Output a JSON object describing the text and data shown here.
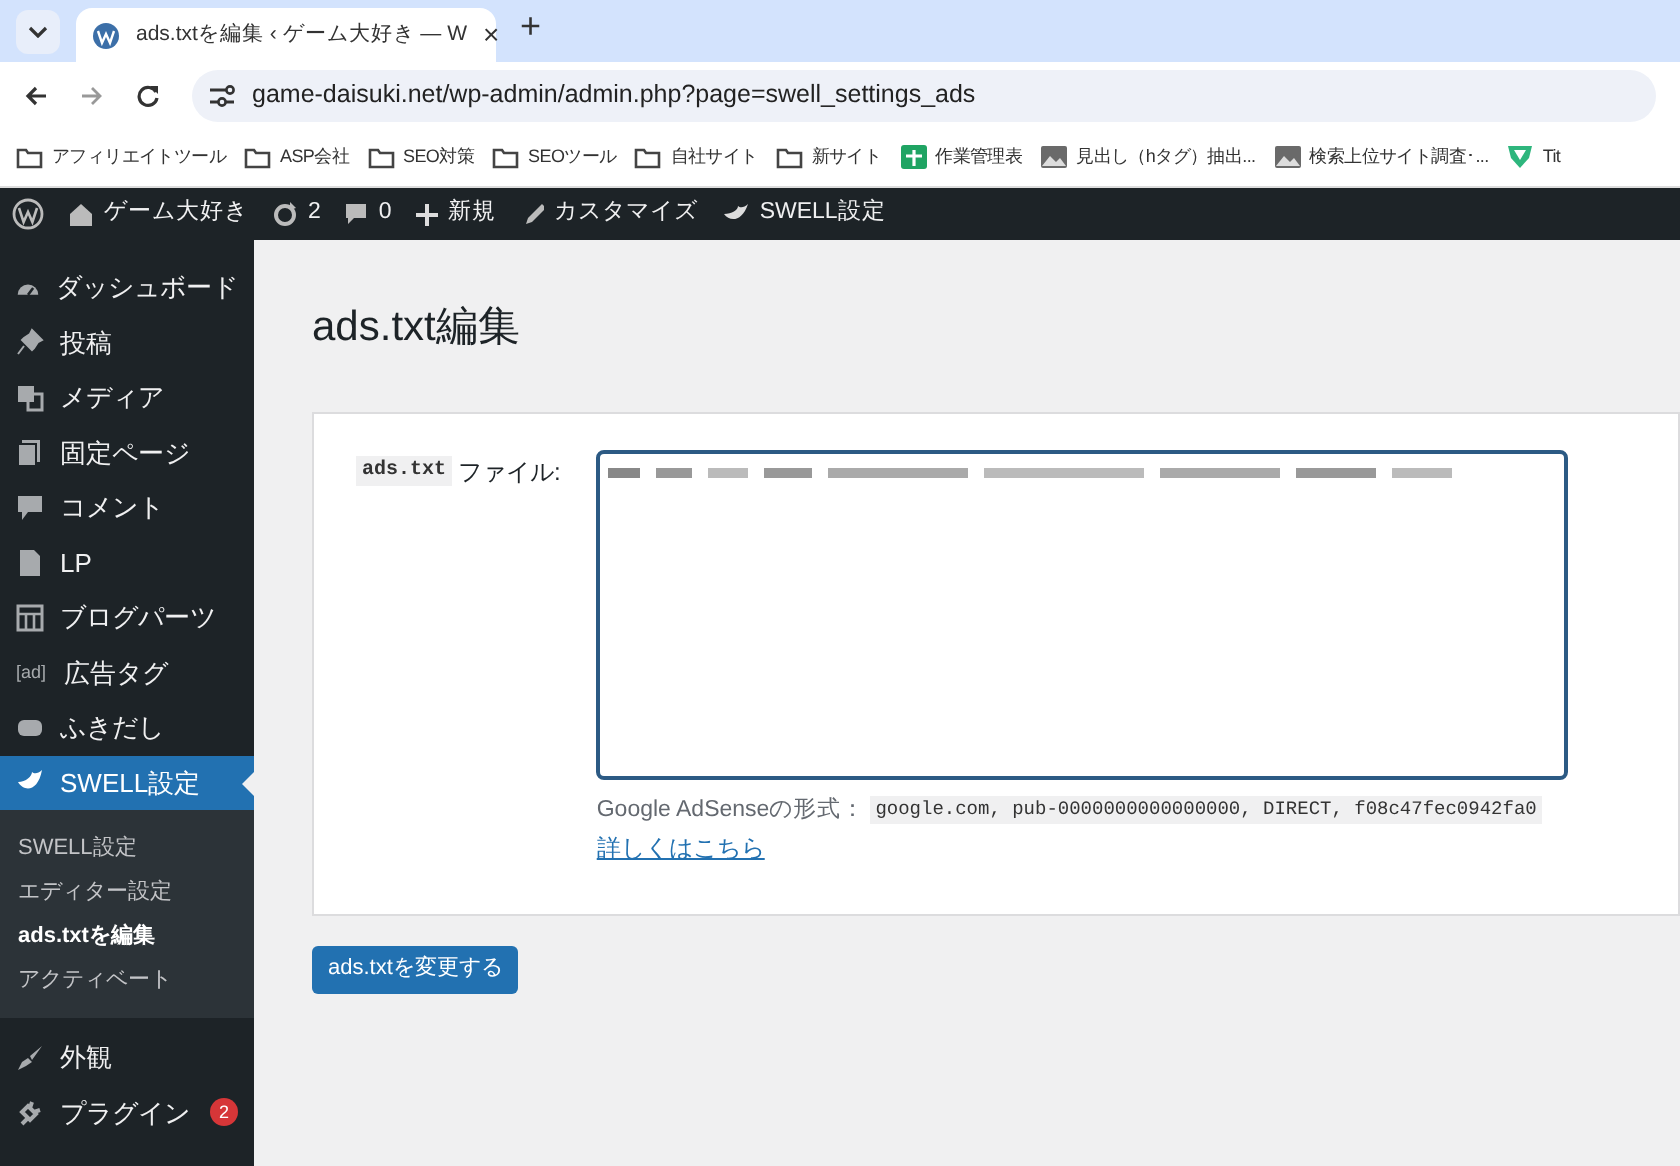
{
  "browser": {
    "tab": {
      "title": "ads.txtを編集 ‹ ゲーム大好き — W",
      "close": "×"
    },
    "new_tab": "+",
    "url": "game-daisuki.net/wp-admin/admin.php?page=swell_settings_ads",
    "bookmarks": [
      {
        "kind": "folder",
        "label": "アフィリエイトツール"
      },
      {
        "kind": "folder",
        "label": "ASP会社"
      },
      {
        "kind": "folder",
        "label": "SEO対策"
      },
      {
        "kind": "folder",
        "label": "SEOツール"
      },
      {
        "kind": "folder",
        "label": "自社サイト"
      },
      {
        "kind": "folder",
        "label": "新サイト"
      },
      {
        "kind": "sheet",
        "label": "作業管理表"
      },
      {
        "kind": "image",
        "label": "見出し（hタグ）抽出..."
      },
      {
        "kind": "image",
        "label": "検索上位サイト調査･..."
      },
      {
        "kind": "shield",
        "label": "Tit"
      }
    ]
  },
  "admin_bar": {
    "site": "ゲーム大好き",
    "updates": "2",
    "comments": "0",
    "new": "新規",
    "customize": "カスタマイズ",
    "swell": "SWELL設定"
  },
  "sidebar": {
    "items": [
      {
        "kind": "dashboard",
        "label": "ダッシュボード",
        "selected": false
      },
      {
        "kind": "pin",
        "label": "投稿",
        "selected": false
      },
      {
        "kind": "media",
        "label": "メディア",
        "selected": false
      },
      {
        "kind": "pages",
        "label": "固定ページ",
        "selected": false
      },
      {
        "kind": "comment",
        "label": "コメント",
        "selected": false
      },
      {
        "kind": "page",
        "label": "LP",
        "selected": false
      },
      {
        "kind": "grid",
        "label": "ブログパーツ",
        "selected": false
      },
      {
        "kind": "ad",
        "label": "広告タグ",
        "icon_text": "[ad]",
        "selected": false
      },
      {
        "kind": "bubble",
        "label": "ふきだし",
        "selected": false
      },
      {
        "kind": "swell",
        "label": "SWELL設定",
        "selected": true,
        "children": [
          {
            "label": "SWELL設定",
            "selected": false
          },
          {
            "label": "エディター設定",
            "selected": false
          },
          {
            "label": "ads.txtを編集",
            "selected": true
          },
          {
            "label": "アクティベート",
            "selected": false
          }
        ]
      },
      {
        "kind": "brush",
        "label": "外観",
        "selected": false
      },
      {
        "kind": "plug",
        "label": "プラグイン",
        "badge": "2",
        "selected": false
      }
    ]
  },
  "page": {
    "title": "ads.txt編集",
    "field_label_code": "ads.txt",
    "field_label": "ファイル:",
    "hint_label": "Google AdSenseの形式：",
    "hint_code": "google.com, pub-0000000000000000, DIRECT, f08c47fec0942fa0",
    "link": "詳しくはこちら",
    "submit": "ads.txtを変更する"
  }
}
